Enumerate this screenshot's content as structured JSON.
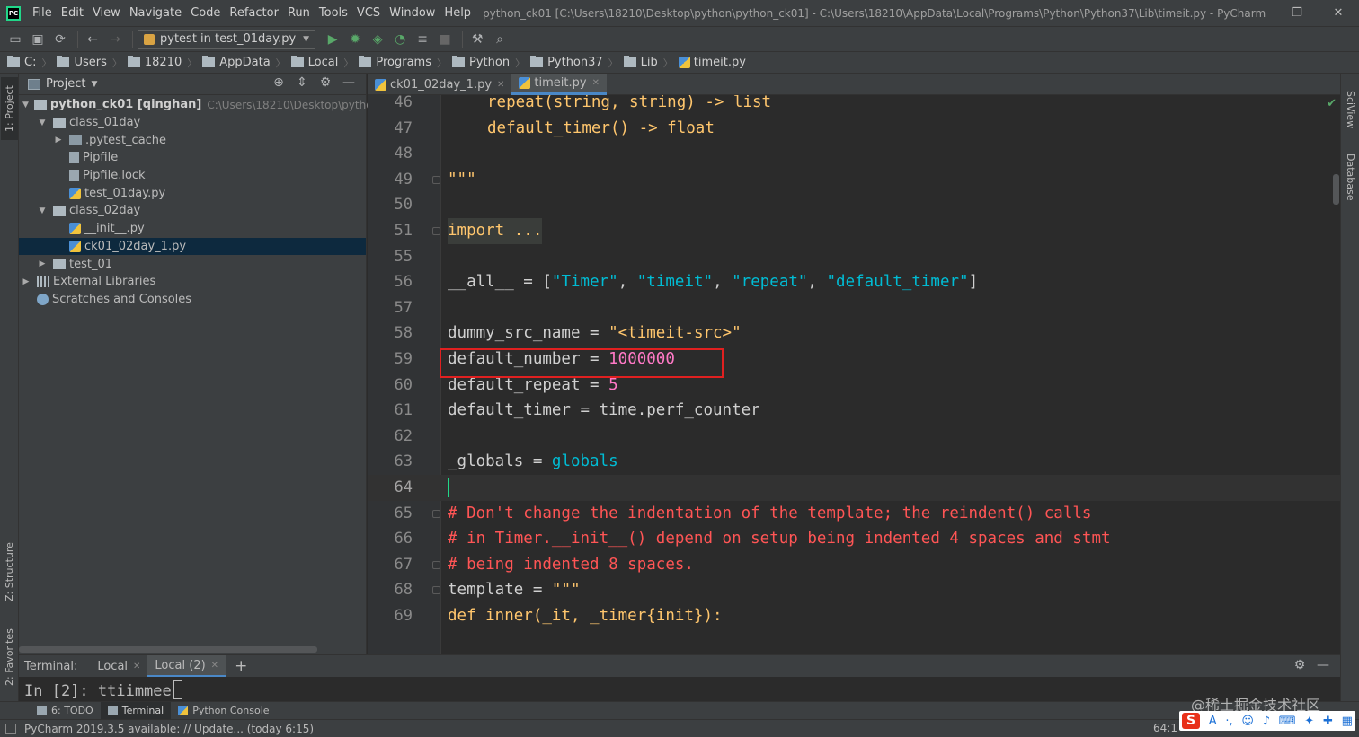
{
  "window": {
    "title": "python_ck01 [C:\\Users\\18210\\Desktop\\python\\python_ck01] - C:\\Users\\18210\\AppData\\Local\\Programs\\Python\\Python37\\Lib\\timeit.py - PyCharm",
    "minimize": "—",
    "restore": "❐",
    "close": "✕"
  },
  "menu": [
    "File",
    "Edit",
    "View",
    "Navigate",
    "Code",
    "Refactor",
    "Run",
    "Tools",
    "VCS",
    "Window",
    "Help"
  ],
  "toolbar": {
    "run_config": "pytest in test_01day.py"
  },
  "breadcrumb": [
    "C:",
    "Users",
    "18210",
    "AppData",
    "Local",
    "Programs",
    "Python",
    "Python37",
    "Lib",
    "timeit.py"
  ],
  "left_strip": {
    "project_tab": "1: Project",
    "structure_tab": "Z: Structure",
    "favorites_tab": "2: Favorites"
  },
  "right_strip": {
    "sciview_tab": "SciView",
    "database_tab": "Database"
  },
  "project_panel": {
    "title": "Project",
    "tree": [
      {
        "label": "python_ck01 [qinghan]",
        "hint": "C:\\Users\\18210\\Desktop\\python\\py"
      },
      {
        "label": "class_01day"
      },
      {
        "label": ".pytest_cache"
      },
      {
        "label": "Pipfile"
      },
      {
        "label": "Pipfile.lock"
      },
      {
        "label": "test_01day.py"
      },
      {
        "label": "class_02day"
      },
      {
        "label": "__init__.py"
      },
      {
        "label": "ck01_02day_1.py"
      },
      {
        "label": "test_01"
      },
      {
        "label": "External Libraries"
      },
      {
        "label": "Scratches and Consoles"
      }
    ]
  },
  "editor_tabs": [
    {
      "label": "ck01_02day_1.py"
    },
    {
      "label": "timeit.py"
    }
  ],
  "editor": {
    "line_numbers": [
      "46",
      "47",
      "48",
      "49",
      "50",
      "51",
      "55",
      "56",
      "57",
      "58",
      "59",
      "60",
      "61",
      "62",
      "63",
      "64",
      "65",
      "66",
      "67",
      "68",
      "69"
    ],
    "code": {
      "l46a": "repeat(string, string) -> list",
      "l47a": "default_timer() -> float",
      "l49": "\"\"\"",
      "l51": "import ...",
      "l56_a": "__all__",
      "l56_b": " = [",
      "l56_c": "\"Timer\"",
      "l56_d": ", ",
      "l56_e": "\"timeit\"",
      "l56_f": ", ",
      "l56_g": "\"repeat\"",
      "l56_h": ", ",
      "l56_i": "\"default_timer\"",
      "l56_j": "]",
      "l58_a": "dummy_src_name = ",
      "l58_b": "\"<timeit-src>\"",
      "l59_a": "default_number = ",
      "l59_b": "1000000",
      "l60_a": "default_repeat = ",
      "l60_b": "5",
      "l61": "default_timer = time.perf_counter",
      "l63_a": "_globals = ",
      "l63_b": "globals",
      "l65": "# Don't change the indentation of the template; the reindent() calls",
      "l66": "# in Timer.__init__() depend on setup being indented 4 spaces and stmt",
      "l67": "# being indented 8 spaces.",
      "l68_a": "template = ",
      "l68_b": "\"\"\"",
      "l69": "def inner(_it, _timer{init}):"
    }
  },
  "terminal": {
    "label": "Terminal:",
    "tabs": [
      "Local",
      "Local (2)"
    ],
    "prompt": "In [2]: ttiimmee"
  },
  "bottom_tabs": [
    "6: TODO",
    "Terminal",
    "Python Console"
  ],
  "status": {
    "message": "PyCharm 2019.3.5 available: // Update... (today 6:15)",
    "position": "64:1"
  },
  "watermark": "@稀土掘金技术社区",
  "colors": {
    "accent": "#4a88c7",
    "highlight_box": "#e02020",
    "caret": "#21d789"
  }
}
